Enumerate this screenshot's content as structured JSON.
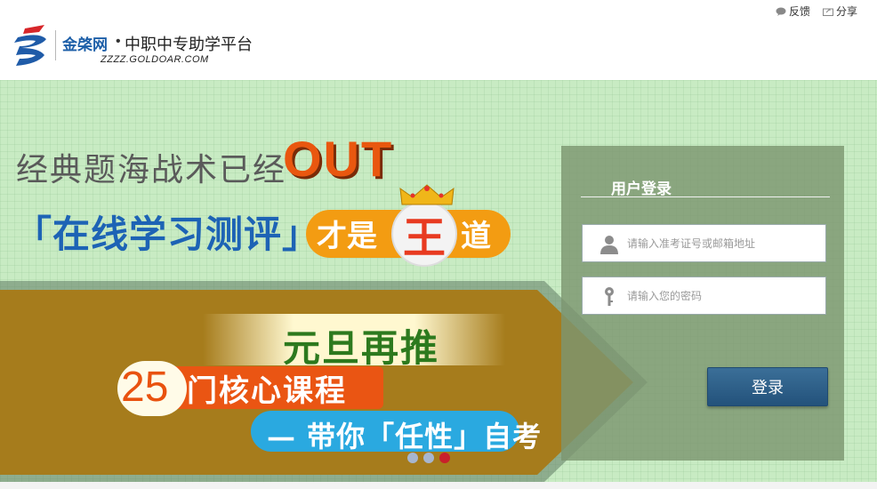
{
  "header": {
    "links": [
      {
        "label": "反馈",
        "icon": "comment-icon"
      },
      {
        "label": "分享",
        "icon": "share-icon"
      }
    ],
    "brand": "金棨网",
    "brand_dot": "•",
    "tagline": "中职中专助学平台",
    "domain": "ZZZZ.GOLDOAR.COM"
  },
  "banner": {
    "headline1": "经典题海战术已经",
    "out": "OUT",
    "headline2": "「在线学习测评」",
    "badge_part1": "才是",
    "badge_wang": "王",
    "badge_part2": "道",
    "promo_line1": "元旦再推",
    "promo_number": "25",
    "promo_line2": "门核心课程",
    "promo_line3": "— 带你「任性」自考",
    "slides": 3,
    "active_slide": 3
  },
  "login": {
    "title": "用户登录",
    "username_placeholder": "请输入准考证号或邮箱地址",
    "password_placeholder": "请输入您的密码",
    "submit_label": "登录"
  },
  "colors": {
    "brand_blue": "#1d5fa8",
    "accent_orange": "#e9570f",
    "banner_green": "#c8ebc3",
    "button_blue": "#2d5f88"
  }
}
